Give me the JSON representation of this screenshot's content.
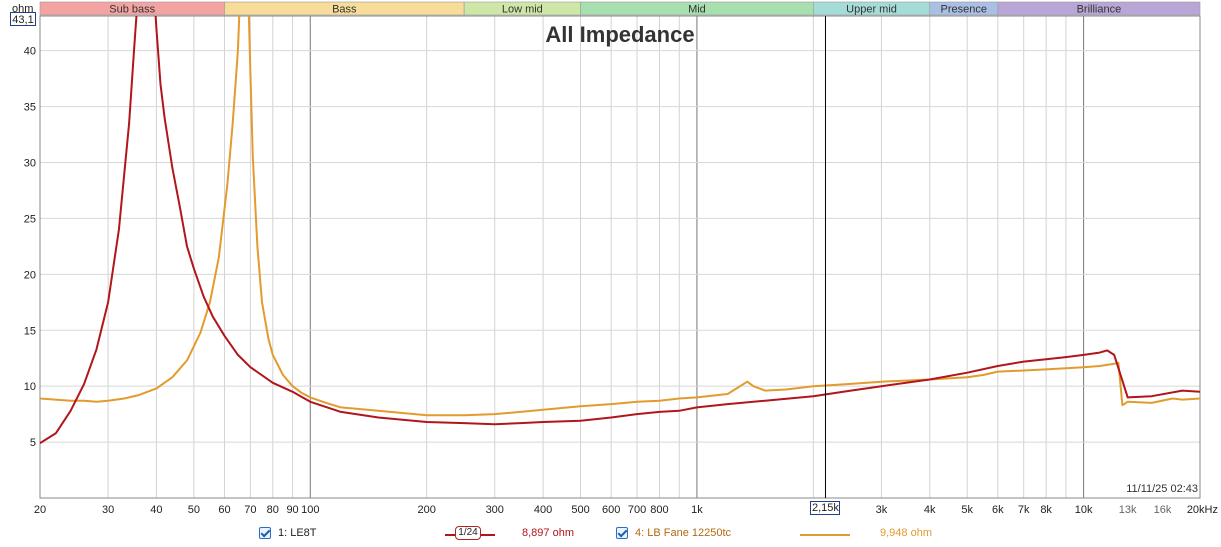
{
  "title": "All Impedance",
  "y_unit": "ohm",
  "y_cursor_value": "43,1",
  "x_cursor_value": "2,15k",
  "timestamp": "11/11/25 02:43",
  "bands": [
    {
      "label": "Sub bass",
      "from": 20,
      "to": 60,
      "color": "#f4a3a3"
    },
    {
      "label": "Bass",
      "from": 60,
      "to": 250,
      "color": "#f7dc9a"
    },
    {
      "label": "Low mid",
      "from": 250,
      "to": 500,
      "color": "#cfe7a6"
    },
    {
      "label": "Mid",
      "from": 500,
      "to": 2000,
      "color": "#a8dfae"
    },
    {
      "label": "Upper mid",
      "from": 2000,
      "to": 4000,
      "color": "#a6dcd7"
    },
    {
      "label": "Presence",
      "from": 4000,
      "to": 6000,
      "color": "#a9bfe6"
    },
    {
      "label": "Brilliance",
      "from": 6000,
      "to": 20000,
      "color": "#b9a6d6"
    }
  ],
  "legend": {
    "series1": {
      "label": "1: LE8T",
      "value": "8,897 ohm",
      "color": "#b0161b"
    },
    "smoothing": {
      "label": "1/24"
    },
    "series2": {
      "label": "4: LB Fane 12250tc",
      "value": "9,948 ohm",
      "color": "#e39b2d"
    }
  },
  "chart_data": {
    "type": "line",
    "title": "All Impedance",
    "xlabel": "",
    "ylabel": "ohm",
    "x_scale": "log",
    "xlim": [
      20,
      20000
    ],
    "ylim": [
      0,
      43.1
    ],
    "grid": true,
    "x_ticks": [
      {
        "v": 20,
        "t": "20"
      },
      {
        "v": 30,
        "t": "30"
      },
      {
        "v": 40,
        "t": "40"
      },
      {
        "v": 50,
        "t": "50"
      },
      {
        "v": 60,
        "t": "60"
      },
      {
        "v": 70,
        "t": "70"
      },
      {
        "v": 80,
        "t": "80"
      },
      {
        "v": 90,
        "t": "90"
      },
      {
        "v": 100,
        "t": "100"
      },
      {
        "v": 200,
        "t": "200"
      },
      {
        "v": 300,
        "t": "300"
      },
      {
        "v": 400,
        "t": "400"
      },
      {
        "v": 500,
        "t": "500"
      },
      {
        "v": 600,
        "t": "600"
      },
      {
        "v": 700,
        "t": "700"
      },
      {
        "v": 800,
        "t": "800"
      },
      {
        "v": 1000,
        "t": "1k"
      },
      {
        "v": 3000,
        "t": "3k"
      },
      {
        "v": 4000,
        "t": "4k"
      },
      {
        "v": 5000,
        "t": "5k"
      },
      {
        "v": 6000,
        "t": "6k"
      },
      {
        "v": 7000,
        "t": "7k"
      },
      {
        "v": 8000,
        "t": "8k"
      },
      {
        "v": 10000,
        "t": "10k"
      },
      {
        "v": 13000,
        "t": "13k"
      },
      {
        "v": 16000,
        "t": "16k"
      },
      {
        "v": 20000,
        "t": "20kHz"
      }
    ],
    "y_ticks": [
      5,
      10,
      15,
      20,
      25,
      30,
      35,
      40
    ],
    "cursor_x": 2150,
    "series": [
      {
        "name": "1: LE8T",
        "color": "#b0161b",
        "x": [
          20,
          22,
          24,
          26,
          28,
          30,
          32,
          34,
          35,
          36,
          37,
          38,
          39,
          40,
          41,
          42,
          44,
          46,
          48,
          50,
          53,
          56,
          60,
          65,
          70,
          80,
          90,
          100,
          120,
          150,
          200,
          250,
          300,
          350,
          400,
          500,
          600,
          700,
          800,
          900,
          1000,
          1200,
          1500,
          2000,
          2500,
          3000,
          4000,
          5000,
          6000,
          7000,
          8000,
          9000,
          10000,
          11000,
          11500,
          12000,
          13000,
          15000,
          18000,
          20000
        ],
        "y": [
          4.9,
          5.8,
          7.8,
          10.2,
          13.3,
          17.5,
          24.0,
          33.5,
          40.0,
          46,
          50,
          51,
          48,
          42,
          37,
          34,
          29.5,
          26,
          22.5,
          20.5,
          18,
          16.2,
          14.5,
          12.8,
          11.7,
          10.3,
          9.5,
          8.6,
          7.7,
          7.2,
          6.8,
          6.7,
          6.6,
          6.7,
          6.8,
          6.9,
          7.2,
          7.5,
          7.7,
          7.8,
          8.1,
          8.4,
          8.7,
          9.1,
          9.6,
          10.0,
          10.6,
          11.2,
          11.8,
          12.2,
          12.4,
          12.6,
          12.8,
          13.0,
          13.2,
          12.8,
          9.0,
          9.1,
          9.6,
          9.5
        ]
      },
      {
        "name": "4: LB Fane 12250tc",
        "color": "#e39b2d",
        "x": [
          20,
          24,
          26,
          28,
          30,
          33,
          36,
          40,
          44,
          48,
          52,
          55,
          58,
          61,
          63,
          65,
          66,
          67,
          68,
          69,
          70,
          71,
          73,
          75,
          78,
          80,
          85,
          90,
          95,
          100,
          110,
          120,
          150,
          200,
          250,
          300,
          350,
          400,
          500,
          600,
          700,
          800,
          900,
          1000,
          1200,
          1350,
          1400,
          1500,
          1700,
          2000,
          2500,
          3000,
          4000,
          5000,
          5500,
          6000,
          7000,
          8000,
          9000,
          10000,
          11000,
          12000,
          12300,
          12600,
          13000,
          15000,
          17000,
          18000,
          20000
        ],
        "y": [
          8.9,
          8.7,
          8.7,
          8.6,
          8.7,
          8.9,
          9.2,
          9.8,
          10.8,
          12.3,
          14.8,
          17.5,
          21.5,
          28,
          33.5,
          40,
          46,
          50,
          50,
          46,
          38,
          30.5,
          22.5,
          17.5,
          14.2,
          12.8,
          11.0,
          10.0,
          9.4,
          9.0,
          8.5,
          8.1,
          7.8,
          7.4,
          7.4,
          7.5,
          7.7,
          7.9,
          8.2,
          8.4,
          8.6,
          8.7,
          8.9,
          9.0,
          9.3,
          10.4,
          10.0,
          9.6,
          9.7,
          10.0,
          10.2,
          10.4,
          10.6,
          10.8,
          11.0,
          11.3,
          11.4,
          11.5,
          11.6,
          11.7,
          11.8,
          12.0,
          12.1,
          8.3,
          8.6,
          8.5,
          8.9,
          8.8,
          8.9
        ]
      }
    ]
  }
}
